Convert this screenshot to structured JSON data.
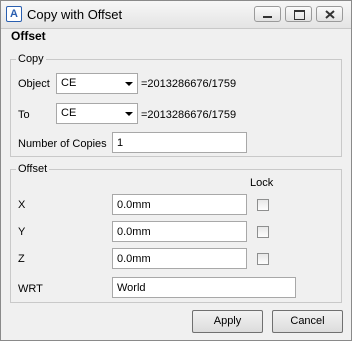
{
  "window": {
    "title": "Copy with Offset",
    "app_icon": "A",
    "controls": [
      "minimize-icon",
      "maximize-icon",
      "close-icon"
    ]
  },
  "menubar": {
    "items": [
      "Offset"
    ]
  },
  "copy_group": {
    "legend": "Copy",
    "object": {
      "label": "Object",
      "value": "CE",
      "ref": "=2013286676/1759"
    },
    "to": {
      "label": "To",
      "value": "CE",
      "ref": "=2013286676/1759"
    },
    "copies": {
      "label": "Number of Copies",
      "value": "1"
    }
  },
  "offset_group": {
    "legend": "Offset",
    "lock_header": "Lock",
    "x": {
      "label": "X",
      "value": "0.0mm",
      "locked": false
    },
    "y": {
      "label": "Y",
      "value": "0.0mm",
      "locked": false
    },
    "z": {
      "label": "Z",
      "value": "0.0mm",
      "locked": false
    },
    "wrt": {
      "label": "WRT",
      "value": "World"
    }
  },
  "buttons": {
    "apply": "Apply",
    "cancel": "Cancel"
  }
}
